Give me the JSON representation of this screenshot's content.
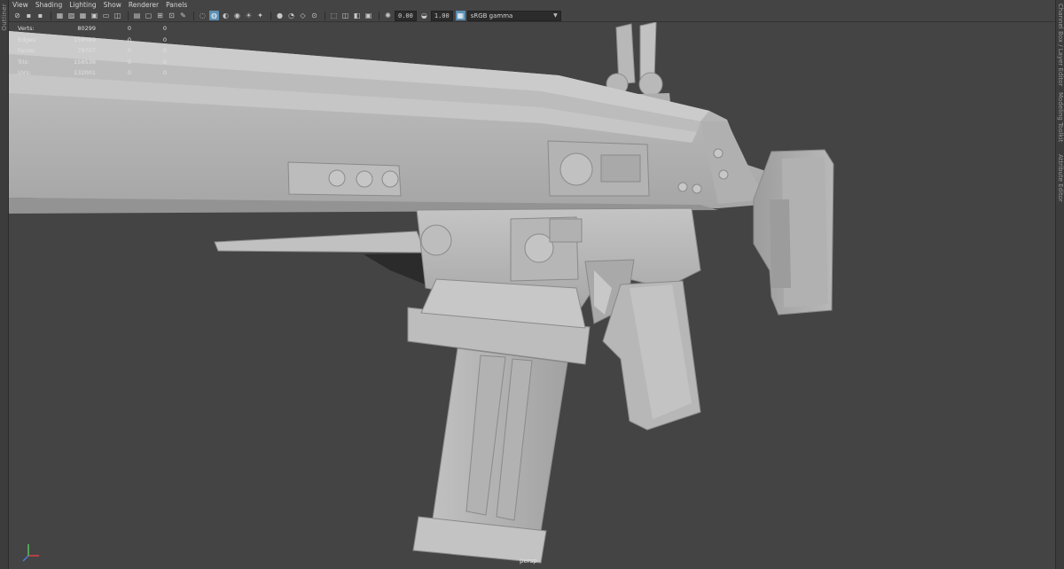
{
  "left_panel": {
    "label": "Outliner"
  },
  "right_panel": {
    "tabs": [
      "Channel Box / Layer Editor",
      "Modeling Toolkit",
      "Attribute Editor"
    ]
  },
  "menu": [
    "View",
    "Shading",
    "Lighting",
    "Show",
    "Renderer",
    "Panels"
  ],
  "toolbar": {
    "exposure_value": "0.00",
    "gamma_value": "1.00",
    "color_space": "sRGB gamma"
  },
  "hud": {
    "rows": [
      {
        "label": "Verts:",
        "value": "80299",
        "c1": "0",
        "c2": "0"
      },
      {
        "label": "Edges:",
        "value": "159589",
        "c1": "0",
        "c2": "0"
      },
      {
        "label": "Faces:",
        "value": "79707",
        "c1": "0",
        "c2": "0"
      },
      {
        "label": "Tris:",
        "value": "158536",
        "c1": "0",
        "c2": "0"
      },
      {
        "label": "UVs:",
        "value": "132001",
        "c1": "0",
        "c2": "0"
      }
    ],
    "camera": "persp"
  },
  "axis": {
    "x_color": "#d64040",
    "y_color": "#58c058",
    "z_color": "#4d79d6"
  },
  "colors": {
    "viewport_bg": "#444444",
    "model_mid": "#b2b2b2",
    "accent": "#5d8fb3"
  }
}
